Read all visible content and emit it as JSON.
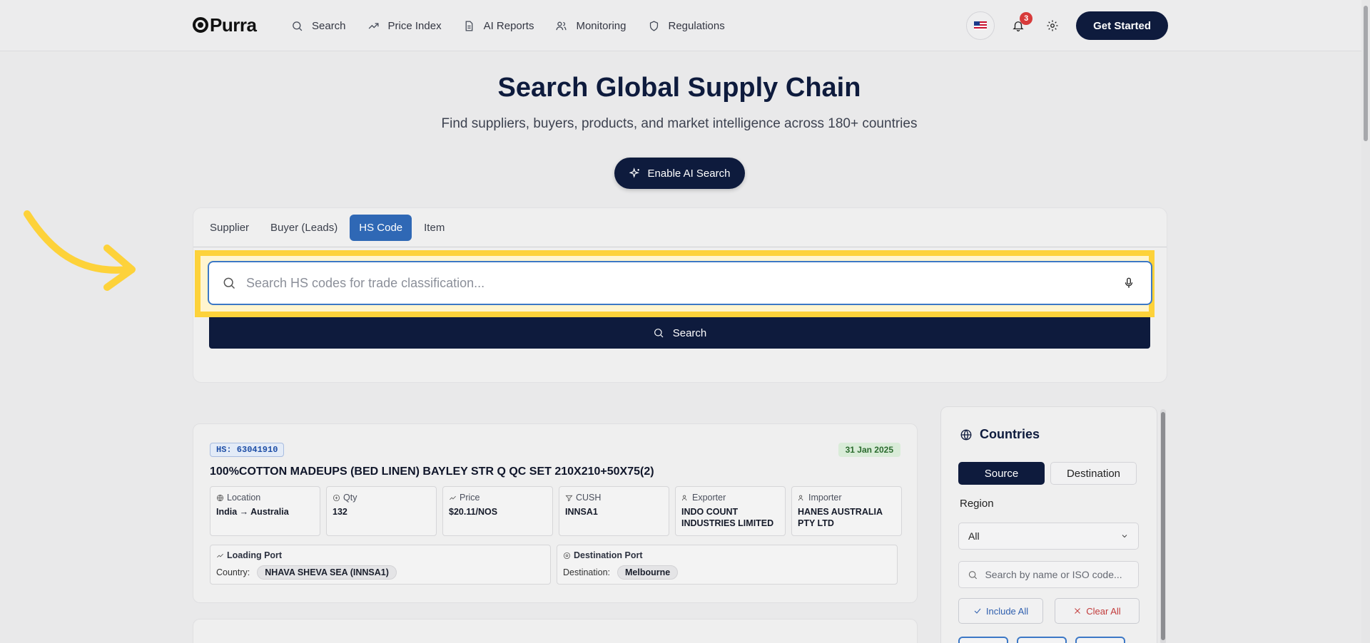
{
  "brand": {
    "name": "Purra"
  },
  "nav": {
    "items": [
      {
        "label": "Search",
        "icon": "search-icon"
      },
      {
        "label": "Price Index",
        "icon": "trend-icon"
      },
      {
        "label": "AI Reports",
        "icon": "document-icon"
      },
      {
        "label": "Monitoring",
        "icon": "users-icon"
      },
      {
        "label": "Regulations",
        "icon": "shield-icon"
      }
    ],
    "notification_count": "3",
    "get_started_label": "Get Started"
  },
  "hero": {
    "title": "Search Global Supply Chain",
    "subtitle": "Find suppliers, buyers, products, and market intelligence across 180+ countries",
    "ai_button_label": "Enable AI Search"
  },
  "search": {
    "tabs": [
      "Supplier",
      "Buyer (Leads)",
      "HS Code",
      "Item"
    ],
    "active_tab": "HS Code",
    "value": "",
    "placeholder": "Search HS codes for trade classification...",
    "button_label": "Search"
  },
  "result": {
    "hs": "HS: 63041910",
    "date": "31 Jan 2025",
    "title": "100%COTTON MADEUPS (BED LINEN) BAYLEY STR Q QC SET 210X210+50X75(2)",
    "fields": [
      {
        "label": "Location",
        "value": "India → Australia"
      },
      {
        "label": "Qty",
        "value": "132"
      },
      {
        "label": "Price",
        "value": "$20.11/NOS"
      },
      {
        "label": "CUSH",
        "value": "INNSA1"
      },
      {
        "label": "Exporter",
        "value": "INDO COUNT INDUSTRIES LIMITED"
      },
      {
        "label": "Importer",
        "value": "HANES AUSTRALIA PTY LTD"
      }
    ],
    "loading_port": {
      "label": "Loading Port",
      "key": "Country:",
      "value": "NHAVA SHEVA SEA (INNSA1)"
    },
    "destination_port": {
      "label": "Destination Port",
      "key": "Destination:",
      "value": "Melbourne"
    }
  },
  "countries": {
    "title": "Countries",
    "source_label": "Source",
    "destination_label": "Destination",
    "region_label": "Region",
    "region_value": "All",
    "search_placeholder": "Search by name or ISO code...",
    "include_all_label": "Include All",
    "clear_all_label": "Clear All"
  },
  "colors": {
    "navy": "#0e1b3d",
    "tab_active": "#2f68b5",
    "highlight": "#fdd23a",
    "date_green": "#2b6b2e",
    "clear_red": "#c23b3b"
  }
}
